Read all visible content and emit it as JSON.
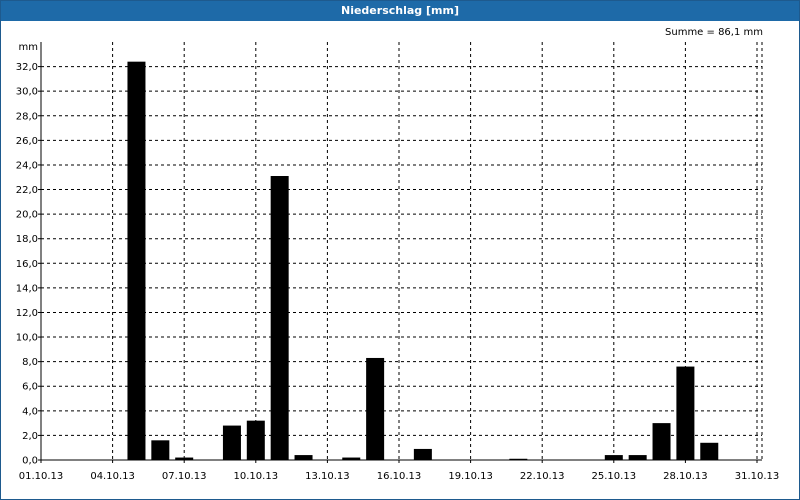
{
  "window": {
    "title": "Niederschlag [mm]"
  },
  "summary": {
    "text": "Summe = 86,1 mm"
  },
  "chart_data": {
    "type": "bar",
    "title": "Niederschlag [mm]",
    "ylabel": "mm",
    "ylim": [
      0,
      34
    ],
    "grid": true,
    "yticks": [
      0,
      2,
      4,
      6,
      8,
      10,
      12,
      14,
      16,
      18,
      20,
      22,
      24,
      26,
      28,
      30,
      32
    ],
    "ytick_labels": [
      "0,0",
      "2,0",
      "4,0",
      "6,0",
      "8,0",
      "10,0",
      "12,0",
      "14,0",
      "16,0",
      "18,0",
      "20,0",
      "22,0",
      "24,0",
      "26,0",
      "28,0",
      "30,0",
      "32,0"
    ],
    "xtick_labels": [
      "01.10.13",
      "04.10.13",
      "07.10.13",
      "10.10.13",
      "13.10.13",
      "16.10.13",
      "19.10.13",
      "22.10.13",
      "25.10.13",
      "28.10.13",
      "31.10.13"
    ],
    "categories": [
      "01.10.13",
      "02.10.13",
      "03.10.13",
      "04.10.13",
      "05.10.13",
      "06.10.13",
      "07.10.13",
      "08.10.13",
      "09.10.13",
      "10.10.13",
      "11.10.13",
      "12.10.13",
      "13.10.13",
      "14.10.13",
      "15.10.13",
      "16.10.13",
      "17.10.13",
      "18.10.13",
      "19.10.13",
      "20.10.13",
      "21.10.13",
      "22.10.13",
      "23.10.13",
      "24.10.13",
      "25.10.13",
      "26.10.13",
      "27.10.13",
      "28.10.13",
      "29.10.13",
      "30.10.13",
      "31.10.13"
    ],
    "values": [
      0,
      0,
      0,
      0,
      32.4,
      1.6,
      0.2,
      0,
      2.8,
      3.2,
      23.1,
      0.4,
      0,
      0.2,
      8.3,
      0,
      0.9,
      0,
      0,
      0,
      0.1,
      0,
      0,
      0,
      0.4,
      0.4,
      3.0,
      7.6,
      1.4,
      0,
      0
    ],
    "bar_color": "#000000"
  }
}
